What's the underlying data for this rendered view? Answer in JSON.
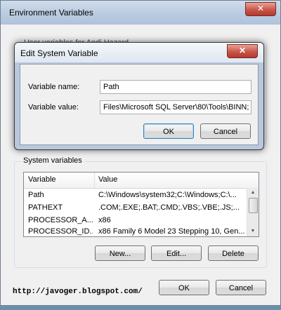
{
  "env_window": {
    "title": "Environment Variables",
    "close_glyph": "✕",
    "user_vars_legend": "User variables for Andi Hazard",
    "system_vars_legend": "System variables",
    "list": {
      "columns": [
        "Variable",
        "Value"
      ],
      "rows": [
        {
          "name": "Path",
          "value": "C:\\Windows\\system32;C:\\Windows;C:\\..."
        },
        {
          "name": "PATHEXT",
          "value": ".COM;.EXE;.BAT;.CMD;.VBS;.VBE;.JS;..."
        },
        {
          "name": "PROCESSOR_A...",
          "value": "x86"
        },
        {
          "name": "PROCESSOR_ID...",
          "value": "x86 Family 6 Model 23 Stepping 10, Gen..."
        }
      ]
    },
    "buttons": {
      "new": "New...",
      "edit": "Edit...",
      "delete": "Delete",
      "ok": "OK",
      "cancel": "Cancel"
    }
  },
  "dialog": {
    "title": "Edit System Variable",
    "close_glyph": "✕",
    "name_label": "Variable name:",
    "name_value": "Path",
    "value_label": "Variable value:",
    "value_value": "Files\\Microsoft SQL Server\\80\\Tools\\BINN;",
    "ok": "OK",
    "cancel": "Cancel"
  },
  "watermark": "http://javoger.blogspot.com/"
}
